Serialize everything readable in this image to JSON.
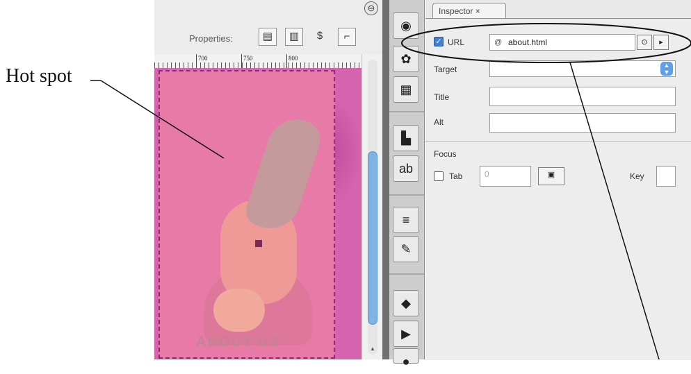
{
  "annotation": {
    "hot_spot_label": "Hot spot"
  },
  "toolbar": {
    "properties_label": "Properties:",
    "icons": [
      "page-icon",
      "layout-icon",
      "dollar-icon",
      "code-icon"
    ]
  },
  "ruler": {
    "labels": [
      "700",
      "750",
      "800"
    ]
  },
  "canvas": {
    "caption": "ABOUT US"
  },
  "inspector": {
    "tab_label": "Inspector",
    "url": {
      "label": "URL",
      "value": "about.html",
      "checked": true
    },
    "target": {
      "label": "Target",
      "value": ""
    },
    "title": {
      "label": "Title",
      "value": ""
    },
    "alt": {
      "label": "Alt",
      "value": ""
    },
    "focus": {
      "section_label": "Focus",
      "tab_label": "Tab",
      "tab_value": "0",
      "key_label": "Key",
      "key_value": ""
    }
  }
}
